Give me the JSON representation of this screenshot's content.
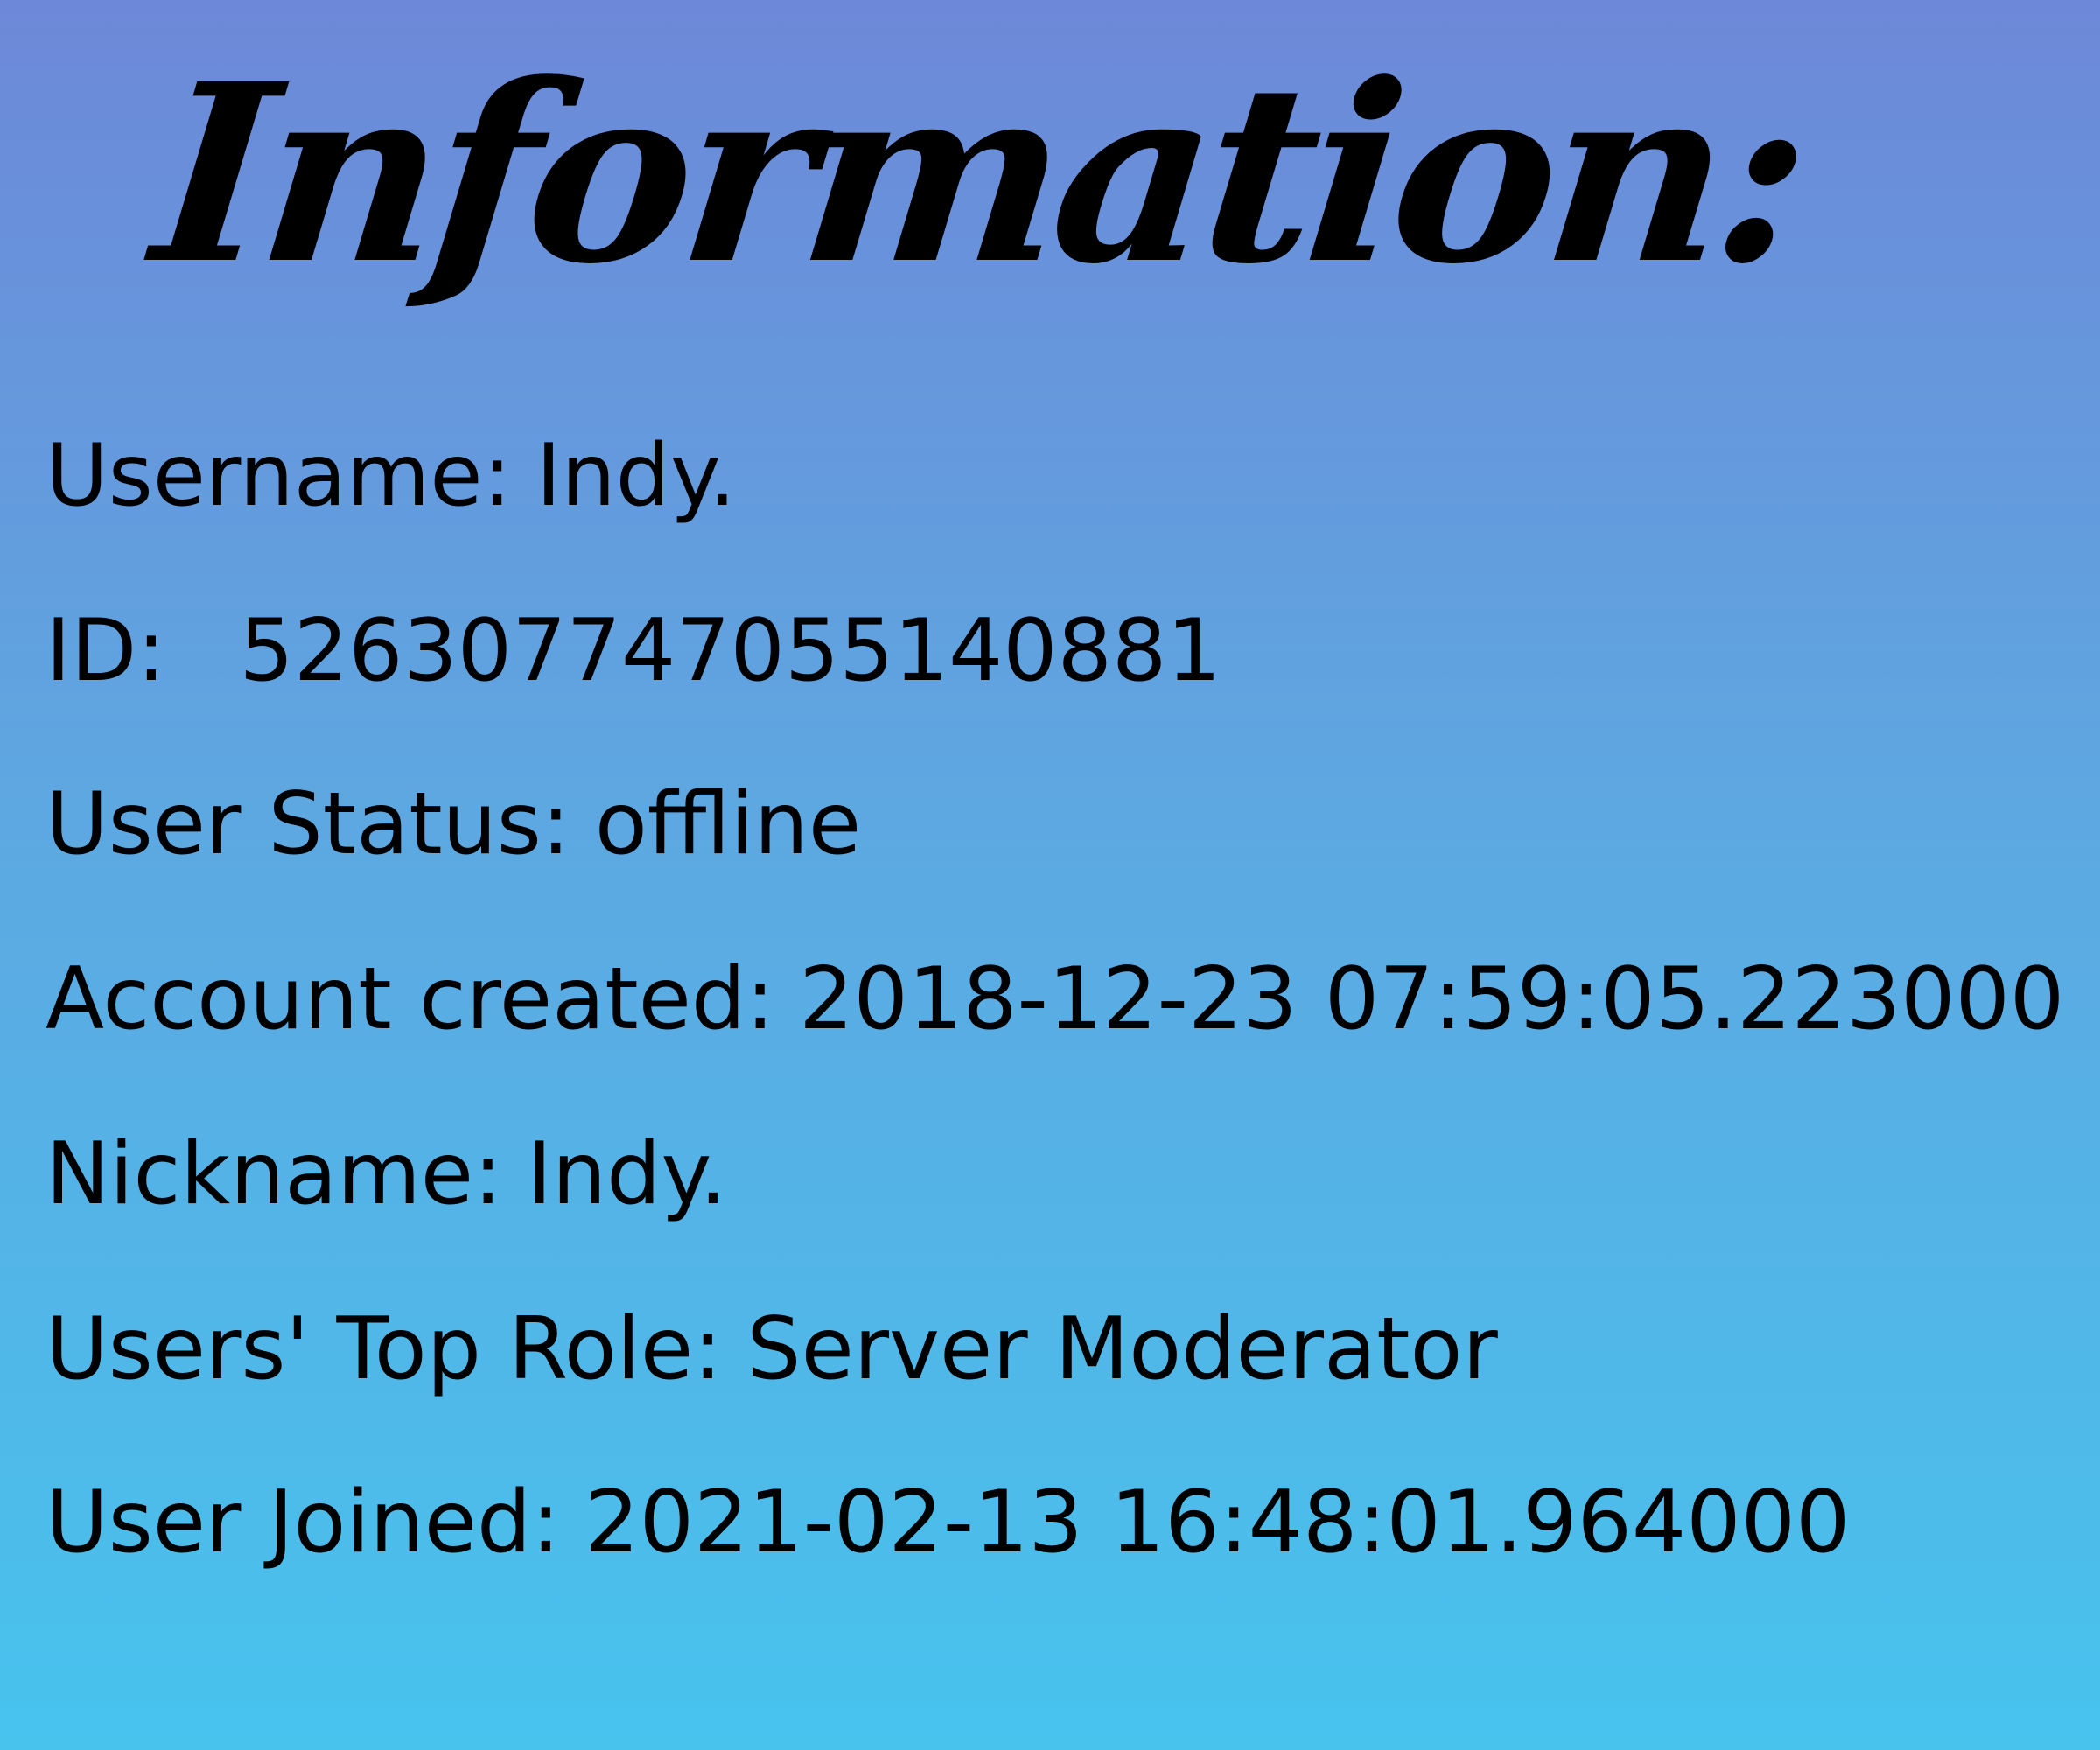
{
  "title": "Information:",
  "fields": {
    "username": {
      "label": "Username:",
      "value": "Indy."
    },
    "id": {
      "label": "ID:",
      "value": "526307747055140881"
    },
    "status": {
      "label": "User Status:",
      "value": "offline"
    },
    "created": {
      "label": "Account created:",
      "value": "2018-12-23 07:59:05.223000"
    },
    "nickname": {
      "label": "Nickname:",
      "value": "Indy."
    },
    "toprole": {
      "label": "Users' Top Role:",
      "value": "Server Moderator"
    },
    "joined": {
      "label": "User Joined:",
      "value": "2021-02-13 16:48:01.964000"
    }
  },
  "colors": {
    "gradient_top": "#6d88d8",
    "gradient_bottom": "#47c3ee",
    "text": "#000000"
  }
}
